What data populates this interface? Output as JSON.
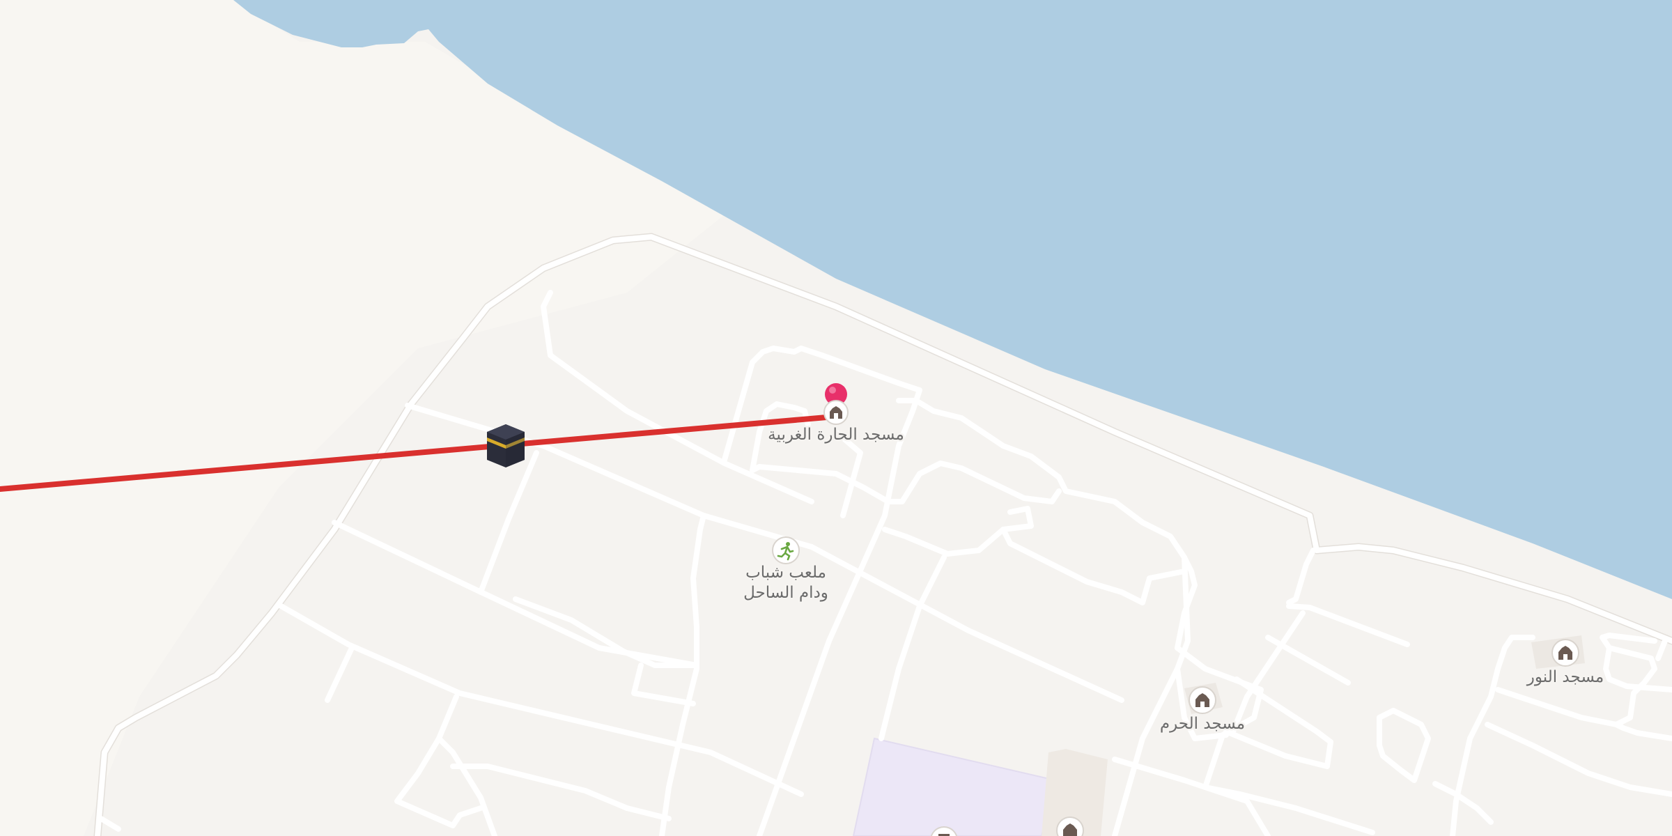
{
  "map": {
    "colors": {
      "water": "#aecde2",
      "land": "#f5f3f0",
      "beach": "#f8f6f3",
      "road": "#ffffff",
      "qibla_line": "#d9302e",
      "pin": "#e8306a",
      "facility_area": "#ece7f7",
      "poi_icon_mosque": "#6a5a52",
      "poi_icon_sports": "#6aa842"
    },
    "qibla_line": {
      "label": "Qibla direction line",
      "marker_icon": "kaaba-icon"
    },
    "location_pin": {
      "icon": "map-pin-icon"
    },
    "pois": [
      {
        "id": "mosque-west",
        "label": "مسجد الحارة الغربية",
        "icon": "mosque-icon"
      },
      {
        "id": "playground",
        "label_line1": "ملعب شباب",
        "label_line2": "ودام الساحل",
        "icon": "running-person-icon"
      },
      {
        "id": "mosque-haram",
        "label": "مسجد الحرم",
        "icon": "mosque-icon"
      },
      {
        "id": "mosque-noor",
        "label": "مسجد النور",
        "icon": "mosque-icon"
      },
      {
        "id": "building-bottom",
        "icon": "building-icon"
      },
      {
        "id": "mosque-bottom",
        "icon": "mosque-icon"
      }
    ]
  }
}
